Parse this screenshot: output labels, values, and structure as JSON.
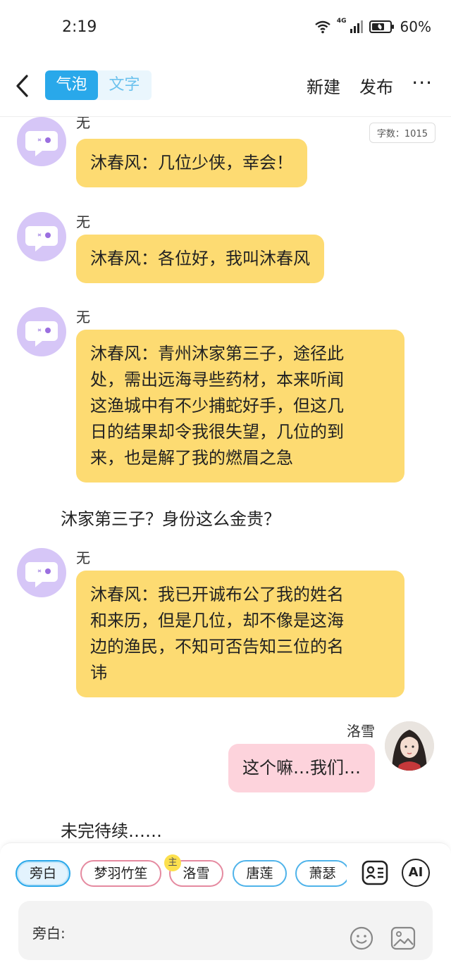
{
  "status_bar": {
    "time": "2:19",
    "network": "4G",
    "battery": "60%"
  },
  "header": {
    "tabs": [
      {
        "label": "气泡",
        "active": true
      },
      {
        "label": "文字",
        "active": false
      }
    ],
    "new_label": "新建",
    "publish_label": "发布",
    "more_label": "···"
  },
  "word_count": "字数：1015",
  "messages": [
    {
      "speaker": "无",
      "text": "沐春风：几位少侠，幸会！"
    },
    {
      "speaker": "无",
      "text": "沐春风：各位好，我叫沐春风"
    },
    {
      "speaker": "无",
      "lines": [
        "沐春风：青州沐家第三子，途径此",
        "处，需出远海寻些药材，本来听闻",
        "这渔城中有不少捕蛇好手，但这几",
        "日的结果却令我很失望，几位的到",
        "来，也是解了我的燃眉之急"
      ]
    },
    {
      "narration": "沐家第三子？身份这么金贵？"
    },
    {
      "speaker": "无",
      "lines": [
        "沐春风：我已开诚布公了我的姓名",
        "和来历，但是几位，却不像是这海",
        "边的渔民，不知可否告知三位的名",
        "讳"
      ]
    },
    {
      "user_name": "洛雪",
      "text": "这个嘛…我们…"
    },
    {
      "narration": "未完待续……"
    }
  ],
  "role_chips": [
    {
      "label": "旁白",
      "active": true
    },
    {
      "label": "梦羽竹笙"
    },
    {
      "label": "洛雪",
      "badge": "主"
    },
    {
      "label": "唐莲"
    },
    {
      "label": "萧瑟"
    }
  ],
  "ai_label": "AI",
  "input": {
    "label": "旁白:"
  },
  "colors": {
    "accent": "#29a8ea",
    "npc_bubble": "#fddb72",
    "user_bubble": "#fdd3dc",
    "avatar_bg": "#d6c6f7"
  }
}
